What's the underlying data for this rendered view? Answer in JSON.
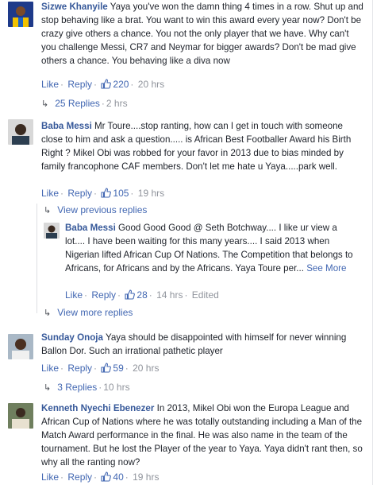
{
  "comments": [
    {
      "author": "Sizwe Khanyile",
      "text": " Yaya you've won the damn thing 4 times in a row. Shut up and stop behaving like a brat. You want to win this award every year now? Don't be crazy give others a chance. You not the only player that we have. Why can't you challenge Messi, CR7 and Neymar for bigger awards? Don't be mad give others a chance. You behaving like a diva now",
      "like": "Like",
      "reply": "Reply",
      "likes": "220",
      "time": "20 hrs",
      "replies_label": "25 Replies",
      "replies_time": "2 hrs"
    },
    {
      "author": "Baba Messi",
      "text": " Mr Toure....stop ranting, how can I get in touch with someone close to him and ask a question..... is African Best Footballer Award his Birth Right ? Mikel Obi was robbed for your favor in 2013 due to bias minded by family francophone CAF members. Don't let me hate u Yaya.....park well.",
      "like": "Like",
      "reply": "Reply",
      "likes": "105",
      "time": "19 hrs",
      "previous_replies": "View previous replies",
      "reply_item": {
        "author": "Baba Messi",
        "text": " Good Good Good @ Seth Botchway.... I like ur view a lot.... I have been waiting for this many years.... I said 2013 when Nigerian lifted African Cup Of Nations. The Competition that belongs to Africans, for Africans and by the Africans. Yaya Toure per... ",
        "see_more": "See More",
        "like": "Like",
        "reply": "Reply",
        "likes": "28",
        "time": "14 hrs",
        "edited": "Edited"
      },
      "more_replies": "View more replies"
    },
    {
      "author": "Sunday Onoja",
      "text": " Yaya should be disappointed with himself for never winning Ballon Dor. Such an irrational pathetic player",
      "like": "Like",
      "reply": "Reply",
      "likes": "59",
      "time": "20 hrs",
      "replies_label": "3 Replies",
      "replies_time": "10 hrs"
    },
    {
      "author": "Kenneth Nyechi Ebenezer",
      "text": " In 2013, Mikel Obi won the Europa League and African Cup of Nations where he was totally outstanding including a Man of the Match Award performance in the final. He was also name in the team of the tournament. But he lost the Player of the year to Yaya. Yaya didn't rant then, so why all the ranting now?",
      "like": "Like",
      "reply": "Reply",
      "likes": "40",
      "time": "19 hrs"
    }
  ],
  "colors": {
    "link": "#365899",
    "action": "#4267b2",
    "muted": "#90949c"
  },
  "icons": {
    "like": "thumbs-up-icon",
    "reply_arrow": "reply-arrow-icon"
  }
}
